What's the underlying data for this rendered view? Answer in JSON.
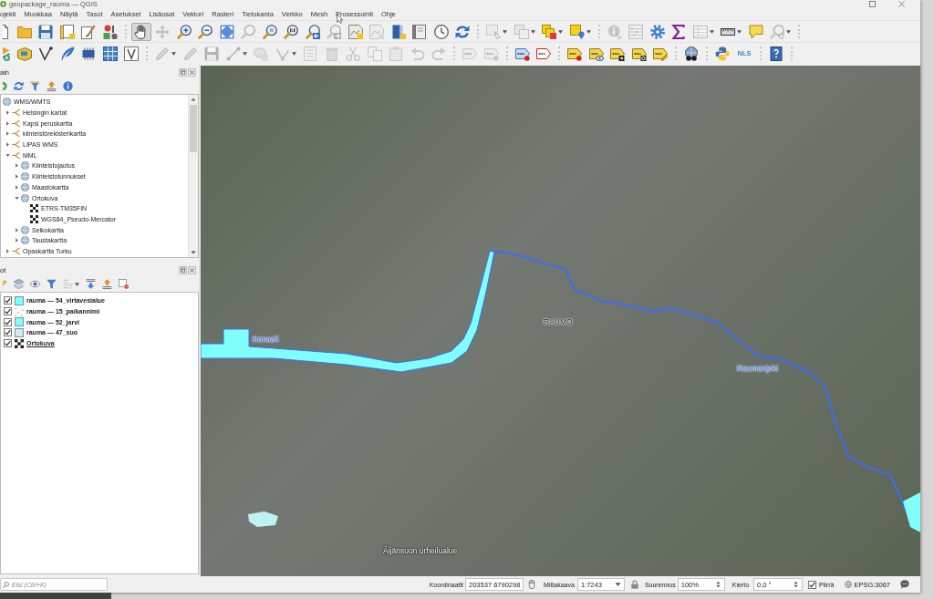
{
  "window": {
    "title": "geopackage_rauma — QGIS"
  },
  "menu_bar": [
    "ojekti",
    "Muokkaa",
    "Näytä",
    "Tasot",
    "Asetukset",
    "Lisäosat",
    "Vektori",
    "Rasteri",
    "Tietokanta",
    "Verkko",
    "Mesh",
    "Prosessointi",
    "Ohje"
  ],
  "toolbars": [
    {
      "buttons": [
        {
          "disabled": false,
          "active": false
        },
        {
          "disabled": false,
          "active": false
        },
        {
          "disabled": false,
          "active": false
        },
        {
          "disabled": false,
          "active": false
        },
        {
          "disabled": false,
          "active": false
        },
        {
          "disabled": false,
          "active": false
        },
        {
          "disabled": false,
          "active": true
        },
        {
          "disabled": true,
          "active": false
        },
        {
          "disabled": false,
          "active": false
        },
        {
          "disabled": false,
          "active": false
        },
        {
          "disabled": false,
          "active": false
        },
        {
          "disabled": true,
          "active": false
        },
        {
          "disabled": false,
          "active": false
        },
        {
          "disabled": false,
          "active": false
        },
        {
          "disabled": false,
          "active": false
        },
        {
          "disabled": true,
          "active": false
        },
        {
          "disabled": false,
          "active": false
        },
        {
          "disabled": true,
          "active": false
        },
        {
          "disabled": false,
          "active": false
        },
        {
          "disabled": false,
          "active": false
        },
        {
          "disabled": false,
          "active": false
        },
        {
          "disabled": false,
          "active": false
        },
        {
          "disabled": true,
          "active": false
        },
        {
          "disabled": true,
          "active": false
        },
        {
          "disabled": false,
          "active": false
        },
        {
          "disabled": false,
          "active": false
        },
        {
          "disabled": true,
          "active": false
        },
        {
          "disabled": true,
          "active": false
        },
        {
          "disabled": false,
          "active": false
        },
        {
          "disabled": false,
          "active": false
        },
        {
          "disabled": true,
          "active": false
        },
        {
          "disabled": false,
          "active": false
        },
        {
          "disabled": false,
          "active": false
        },
        {
          "disabled": true,
          "active": false
        }
      ]
    },
    {
      "buttons": [
        {
          "disabled": false,
          "active": false
        },
        {
          "disabled": false,
          "active": false
        },
        {
          "disabled": false,
          "active": false
        },
        {
          "disabled": false,
          "active": false
        },
        {
          "disabled": false,
          "active": false
        },
        {
          "disabled": false,
          "active": false
        },
        {
          "disabled": false,
          "active": false
        },
        {
          "disabled": true,
          "active": false
        },
        {
          "disabled": true,
          "active": false
        },
        {
          "disabled": true,
          "active": false
        },
        {
          "disabled": true,
          "active": false
        },
        {
          "disabled": true,
          "active": false
        },
        {
          "disabled": true,
          "active": false
        },
        {
          "disabled": true,
          "active": false
        },
        {
          "disabled": true,
          "active": false
        },
        {
          "disabled": true,
          "active": false
        },
        {
          "disabled": true,
          "active": false
        },
        {
          "disabled": true,
          "active": false
        },
        {
          "disabled": true,
          "active": false
        },
        {
          "disabled": true,
          "active": false
        },
        {
          "disabled": true,
          "active": false
        },
        {
          "disabled": true,
          "active": false
        },
        {
          "disabled": false,
          "active": false
        },
        {
          "disabled": false,
          "active": false
        },
        {
          "disabled": false,
          "active": false
        },
        {
          "disabled": false,
          "active": false
        },
        {
          "disabled": false,
          "active": false
        },
        {
          "disabled": false,
          "active": false
        },
        {
          "disabled": false,
          "active": false
        },
        {
          "disabled": false,
          "active": false
        },
        {
          "disabled": false,
          "active": false
        },
        {
          "label": "NLS",
          "disabled": false,
          "active": false
        },
        {
          "disabled": false,
          "active": false
        }
      ]
    }
  ],
  "browser_panel": {
    "title": "ain",
    "tools": [
      {
        "disabled": false
      },
      {
        "disabled": false
      },
      {
        "disabled": false
      },
      {
        "disabled": false
      },
      {
        "disabled": false
      }
    ],
    "tree": [
      {
        "label": "WMS/WMTS",
        "kind": "provider",
        "children": [
          {
            "label": "Helsingin kartat",
            "kind": "connection",
            "expanded": false
          },
          {
            "label": "Kapsi peruskartta",
            "kind": "connection",
            "expanded": false
          },
          {
            "label": "kiinteistörekisterikartta",
            "kind": "connection",
            "expanded": false
          },
          {
            "label": "LIPAS WMS",
            "kind": "connection",
            "expanded": false
          },
          {
            "label": "MML",
            "kind": "connection",
            "expanded": true,
            "children": [
              {
                "label": "Kiinteistojaotus",
                "kind": "layer",
                "expanded": false
              },
              {
                "label": "Kiinteistotunnukset",
                "kind": "layer",
                "expanded": false
              },
              {
                "label": "Maastokartta",
                "kind": "layer",
                "expanded": false
              },
              {
                "label": "Ortokuva",
                "kind": "layer",
                "expanded": true,
                "children": [
                  {
                    "label": "ETRS-TM35FIN",
                    "kind": "tileset"
                  },
                  {
                    "label": "WGS84_Pseudo-Mercator",
                    "kind": "tileset"
                  }
                ]
              },
              {
                "label": "Selkokartta",
                "kind": "layer",
                "expanded": false
              },
              {
                "label": "Taustakartta",
                "kind": "layer",
                "expanded": false
              }
            ]
          },
          {
            "label": "Opaskartta Turku",
            "kind": "connection",
            "expanded": false
          }
        ]
      }
    ]
  },
  "layers_panel": {
    "title": "ot",
    "tools": [
      {
        "disabled": false
      },
      {
        "disabled": false
      },
      {
        "disabled": false
      },
      {
        "disabled": false
      },
      {
        "disabled": true
      },
      {
        "disabled": false
      },
      {
        "disabled": false
      },
      {
        "disabled": false
      }
    ],
    "layers": [
      {
        "name": "rauma — 54_virtavesialue",
        "checked": true,
        "kind": "fill",
        "color": "#80ffff",
        "underlined": false
      },
      {
        "name": "rauma — 15_paikannimi",
        "checked": true,
        "kind": "points",
        "underlined": false
      },
      {
        "name": "rauma — 52_jarvi",
        "checked": true,
        "kind": "fill",
        "color": "#80ffff",
        "underlined": false
      },
      {
        "name": "rauma — 47_suo",
        "checked": true,
        "kind": "fill",
        "color": "#d5e8ec",
        "underlined": false
      },
      {
        "name": "Ortokuva",
        "checked": true,
        "kind": "raster",
        "underlined": true
      }
    ]
  },
  "map": {
    "labels": [
      {
        "text": "Kanaali",
        "kind": "water"
      },
      {
        "text": "RAUMO",
        "kind": "place"
      },
      {
        "text": "Raumanjoki",
        "kind": "water"
      },
      {
        "text": "Äijänsuon urheilualue",
        "kind": "area"
      }
    ]
  },
  "status_bar": {
    "search_placeholder": "Etsi (Ctrl+K)",
    "coordinate_label": "Koordinaatit",
    "coordinate": "203537 6790298",
    "scale_label": "Mittakaava",
    "scale": "1:7243",
    "magnifier_label": "Suurennus",
    "magnifier": "100%",
    "rotation_label": "Kierto",
    "rotation": "0,0 °",
    "render_checked": true,
    "render_label": "Piirrä",
    "crs": "EPSG:3067"
  }
}
